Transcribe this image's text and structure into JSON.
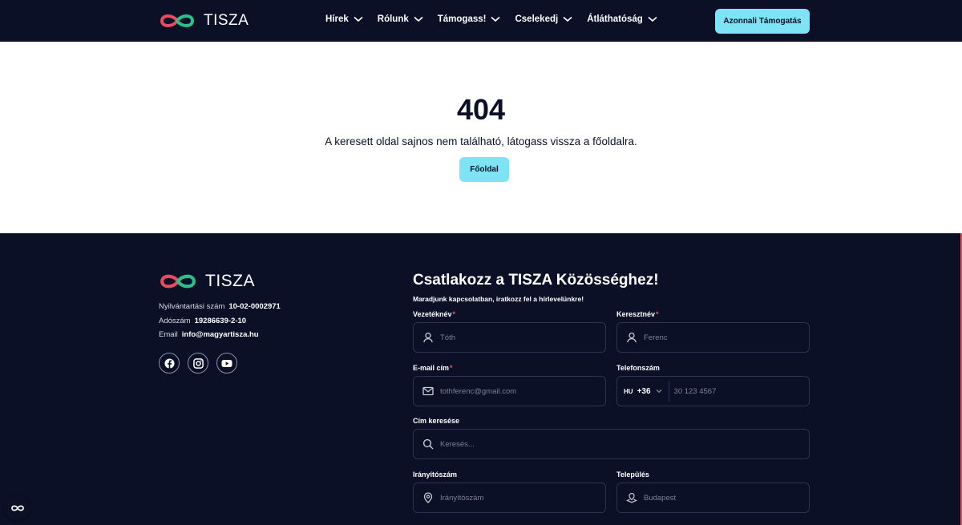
{
  "brand": {
    "name": "TISZA",
    "colors": {
      "accent_red": "#e84a5f",
      "accent_green": "#2bbf8a",
      "cyan_button": "#7de3f5",
      "navy": "#0b1027"
    }
  },
  "header": {
    "nav": [
      {
        "label": "Hírek"
      },
      {
        "label": "Rólunk"
      },
      {
        "label": "Támogass!"
      },
      {
        "label": "Cselekedj"
      },
      {
        "label": "Átláthatóság"
      }
    ],
    "cta_label": "Azonnali Támogatás"
  },
  "error": {
    "code": "404",
    "message": "A keresett oldal sajnos nem található, látogass vissza a főoldalra.",
    "home_button": "Főoldal"
  },
  "footer": {
    "info": [
      {
        "key": "Nyilvántartási szám",
        "value": "10-02-0002971"
      },
      {
        "key": "Adószám",
        "value": "19286639-2-10"
      },
      {
        "key": "Email",
        "value": "info@magyartisza.hu"
      }
    ],
    "socials": [
      "facebook-icon",
      "instagram-icon",
      "youtube-icon"
    ],
    "form": {
      "title": "Csatlakozz a TISZA Közösséghez!",
      "subtitle": "Maradjunk kapcsolatban, iratkozz fel a hírlevelünkre!",
      "lastname": {
        "label": "Vezetéknév",
        "required": "*",
        "placeholder": "Tóth"
      },
      "firstname": {
        "label": "Keresztnév",
        "required": "*",
        "placeholder": "Ferenc"
      },
      "email": {
        "label": "E-mail cím",
        "required": "*",
        "placeholder": "tothferenc@gmail.com"
      },
      "phone": {
        "label": "Telefonszám",
        "country": "HU",
        "dial": "+36",
        "placeholder": "30 123 4567"
      },
      "address": {
        "label": "Cím keresése",
        "placeholder": "Keresés..."
      },
      "zip": {
        "label": "Irányítószám",
        "placeholder": "Irányítószám"
      },
      "city": {
        "label": "Település",
        "placeholder": "Budapest"
      }
    }
  },
  "floating": {
    "icon": "infinity-icon"
  }
}
